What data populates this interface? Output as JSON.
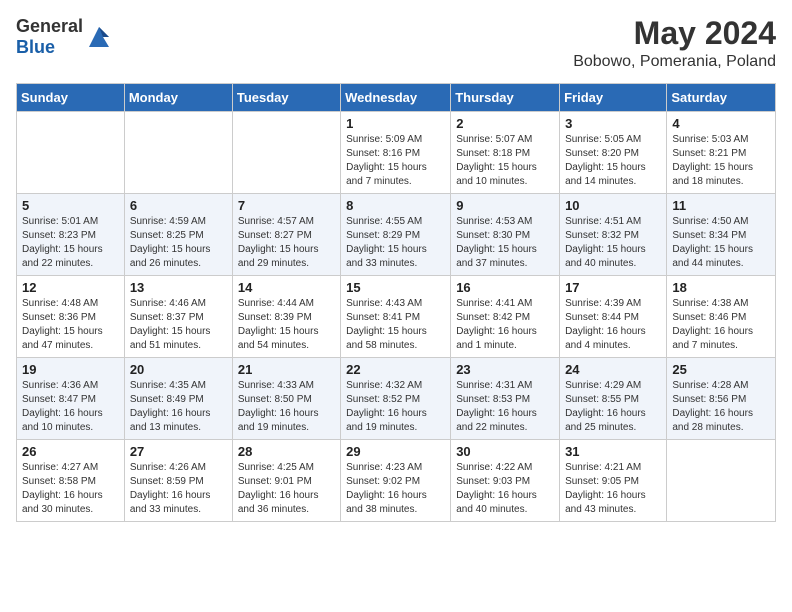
{
  "header": {
    "logo_general": "General",
    "logo_blue": "Blue",
    "month": "May 2024",
    "location": "Bobowo, Pomerania, Poland"
  },
  "weekdays": [
    "Sunday",
    "Monday",
    "Tuesday",
    "Wednesday",
    "Thursday",
    "Friday",
    "Saturday"
  ],
  "weeks": [
    [
      {
        "day": "",
        "sunrise": "",
        "sunset": "",
        "daylight": ""
      },
      {
        "day": "",
        "sunrise": "",
        "sunset": "",
        "daylight": ""
      },
      {
        "day": "",
        "sunrise": "",
        "sunset": "",
        "daylight": ""
      },
      {
        "day": "1",
        "sunrise": "Sunrise: 5:09 AM",
        "sunset": "Sunset: 8:16 PM",
        "daylight": "Daylight: 15 hours and 7 minutes."
      },
      {
        "day": "2",
        "sunrise": "Sunrise: 5:07 AM",
        "sunset": "Sunset: 8:18 PM",
        "daylight": "Daylight: 15 hours and 10 minutes."
      },
      {
        "day": "3",
        "sunrise": "Sunrise: 5:05 AM",
        "sunset": "Sunset: 8:20 PM",
        "daylight": "Daylight: 15 hours and 14 minutes."
      },
      {
        "day": "4",
        "sunrise": "Sunrise: 5:03 AM",
        "sunset": "Sunset: 8:21 PM",
        "daylight": "Daylight: 15 hours and 18 minutes."
      }
    ],
    [
      {
        "day": "5",
        "sunrise": "Sunrise: 5:01 AM",
        "sunset": "Sunset: 8:23 PM",
        "daylight": "Daylight: 15 hours and 22 minutes."
      },
      {
        "day": "6",
        "sunrise": "Sunrise: 4:59 AM",
        "sunset": "Sunset: 8:25 PM",
        "daylight": "Daylight: 15 hours and 26 minutes."
      },
      {
        "day": "7",
        "sunrise": "Sunrise: 4:57 AM",
        "sunset": "Sunset: 8:27 PM",
        "daylight": "Daylight: 15 hours and 29 minutes."
      },
      {
        "day": "8",
        "sunrise": "Sunrise: 4:55 AM",
        "sunset": "Sunset: 8:29 PM",
        "daylight": "Daylight: 15 hours and 33 minutes."
      },
      {
        "day": "9",
        "sunrise": "Sunrise: 4:53 AM",
        "sunset": "Sunset: 8:30 PM",
        "daylight": "Daylight: 15 hours and 37 minutes."
      },
      {
        "day": "10",
        "sunrise": "Sunrise: 4:51 AM",
        "sunset": "Sunset: 8:32 PM",
        "daylight": "Daylight: 15 hours and 40 minutes."
      },
      {
        "day": "11",
        "sunrise": "Sunrise: 4:50 AM",
        "sunset": "Sunset: 8:34 PM",
        "daylight": "Daylight: 15 hours and 44 minutes."
      }
    ],
    [
      {
        "day": "12",
        "sunrise": "Sunrise: 4:48 AM",
        "sunset": "Sunset: 8:36 PM",
        "daylight": "Daylight: 15 hours and 47 minutes."
      },
      {
        "day": "13",
        "sunrise": "Sunrise: 4:46 AM",
        "sunset": "Sunset: 8:37 PM",
        "daylight": "Daylight: 15 hours and 51 minutes."
      },
      {
        "day": "14",
        "sunrise": "Sunrise: 4:44 AM",
        "sunset": "Sunset: 8:39 PM",
        "daylight": "Daylight: 15 hours and 54 minutes."
      },
      {
        "day": "15",
        "sunrise": "Sunrise: 4:43 AM",
        "sunset": "Sunset: 8:41 PM",
        "daylight": "Daylight: 15 hours and 58 minutes."
      },
      {
        "day": "16",
        "sunrise": "Sunrise: 4:41 AM",
        "sunset": "Sunset: 8:42 PM",
        "daylight": "Daylight: 16 hours and 1 minute."
      },
      {
        "day": "17",
        "sunrise": "Sunrise: 4:39 AM",
        "sunset": "Sunset: 8:44 PM",
        "daylight": "Daylight: 16 hours and 4 minutes."
      },
      {
        "day": "18",
        "sunrise": "Sunrise: 4:38 AM",
        "sunset": "Sunset: 8:46 PM",
        "daylight": "Daylight: 16 hours and 7 minutes."
      }
    ],
    [
      {
        "day": "19",
        "sunrise": "Sunrise: 4:36 AM",
        "sunset": "Sunset: 8:47 PM",
        "daylight": "Daylight: 16 hours and 10 minutes."
      },
      {
        "day": "20",
        "sunrise": "Sunrise: 4:35 AM",
        "sunset": "Sunset: 8:49 PM",
        "daylight": "Daylight: 16 hours and 13 minutes."
      },
      {
        "day": "21",
        "sunrise": "Sunrise: 4:33 AM",
        "sunset": "Sunset: 8:50 PM",
        "daylight": "Daylight: 16 hours and 19 minutes."
      },
      {
        "day": "22",
        "sunrise": "Sunrise: 4:32 AM",
        "sunset": "Sunset: 8:52 PM",
        "daylight": "Daylight: 16 hours and 19 minutes."
      },
      {
        "day": "23",
        "sunrise": "Sunrise: 4:31 AM",
        "sunset": "Sunset: 8:53 PM",
        "daylight": "Daylight: 16 hours and 22 minutes."
      },
      {
        "day": "24",
        "sunrise": "Sunrise: 4:29 AM",
        "sunset": "Sunset: 8:55 PM",
        "daylight": "Daylight: 16 hours and 25 minutes."
      },
      {
        "day": "25",
        "sunrise": "Sunrise: 4:28 AM",
        "sunset": "Sunset: 8:56 PM",
        "daylight": "Daylight: 16 hours and 28 minutes."
      }
    ],
    [
      {
        "day": "26",
        "sunrise": "Sunrise: 4:27 AM",
        "sunset": "Sunset: 8:58 PM",
        "daylight": "Daylight: 16 hours and 30 minutes."
      },
      {
        "day": "27",
        "sunrise": "Sunrise: 4:26 AM",
        "sunset": "Sunset: 8:59 PM",
        "daylight": "Daylight: 16 hours and 33 minutes."
      },
      {
        "day": "28",
        "sunrise": "Sunrise: 4:25 AM",
        "sunset": "Sunset: 9:01 PM",
        "daylight": "Daylight: 16 hours and 36 minutes."
      },
      {
        "day": "29",
        "sunrise": "Sunrise: 4:23 AM",
        "sunset": "Sunset: 9:02 PM",
        "daylight": "Daylight: 16 hours and 38 minutes."
      },
      {
        "day": "30",
        "sunrise": "Sunrise: 4:22 AM",
        "sunset": "Sunset: 9:03 PM",
        "daylight": "Daylight: 16 hours and 40 minutes."
      },
      {
        "day": "31",
        "sunrise": "Sunrise: 4:21 AM",
        "sunset": "Sunset: 9:05 PM",
        "daylight": "Daylight: 16 hours and 43 minutes."
      },
      {
        "day": "",
        "sunrise": "",
        "sunset": "",
        "daylight": ""
      }
    ]
  ]
}
